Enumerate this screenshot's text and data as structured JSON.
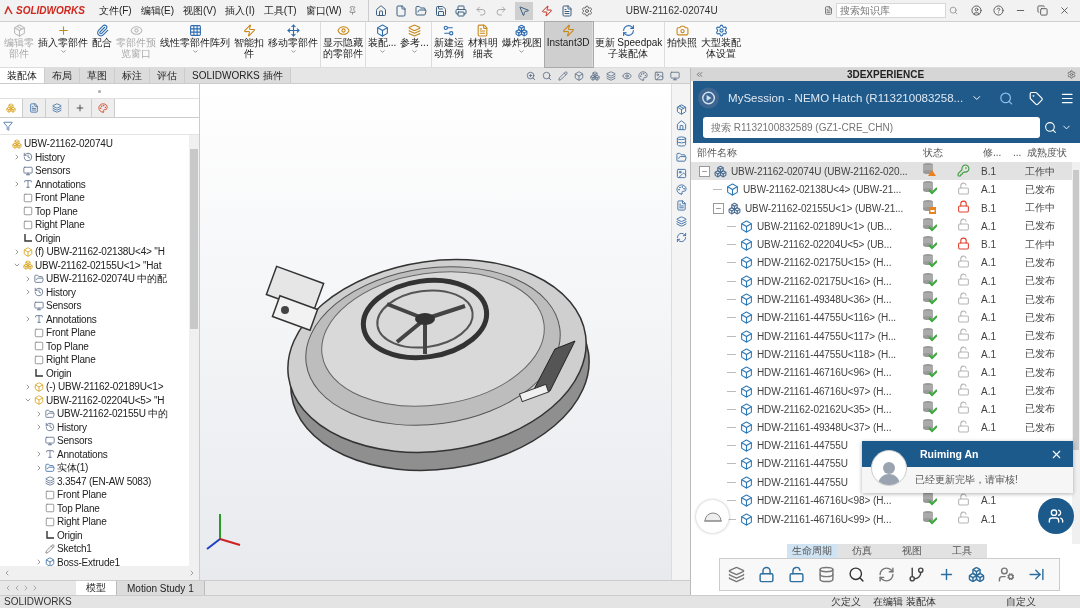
{
  "app": {
    "logo": "SOLIDWORKS",
    "menus": [
      "文件(F)",
      "编辑(E)",
      "视图(V)",
      "插入(I)",
      "工具(T)",
      "窗口(W)"
    ],
    "title": "UBW-21162-02074U",
    "search": {
      "placeholder": "搜索知识库"
    }
  },
  "ribbon": [
    {
      "lines": [
        "编辑零",
        "部件"
      ],
      "disabled": true,
      "selected": false,
      "dropdown": false
    },
    {
      "lines": [
        "插入零部件"
      ],
      "disabled": false,
      "selected": false,
      "dropdown": true
    },
    {
      "lines": [
        "配合"
      ],
      "disabled": false,
      "selected": false,
      "dropdown": false
    },
    {
      "lines": [
        "零部件预",
        "览窗口"
      ],
      "disabled": true,
      "selected": false,
      "dropdown": false
    },
    {
      "lines": [
        "线性零部件阵列"
      ],
      "disabled": false,
      "selected": false,
      "dropdown": true
    },
    {
      "lines": [
        "智能扣",
        "件"
      ],
      "disabled": false,
      "selected": false,
      "dropdown": false
    },
    {
      "lines": [
        "移动零部件"
      ],
      "disabled": false,
      "selected": false,
      "dropdown": true
    },
    {
      "lines": [
        "显示隐藏",
        "的零部件"
      ],
      "disabled": false,
      "selected": false,
      "dropdown": false
    },
    {
      "lines": [
        "装配..."
      ],
      "disabled": false,
      "selected": false,
      "dropdown": true
    },
    {
      "lines": [
        "参考..."
      ],
      "disabled": false,
      "selected": false,
      "dropdown": true
    },
    {
      "lines": [
        "新建运",
        "动算例"
      ],
      "disabled": false,
      "selected": false,
      "dropdown": false
    },
    {
      "lines": [
        "材料明",
        "细表"
      ],
      "disabled": false,
      "selected": false,
      "dropdown": false
    },
    {
      "lines": [
        "爆炸视图"
      ],
      "disabled": false,
      "selected": false,
      "dropdown": true
    },
    {
      "lines": [
        "Instant3D"
      ],
      "disabled": false,
      "selected": true,
      "dropdown": false
    },
    {
      "lines": [
        "更新 Speedpak",
        "子装配体"
      ],
      "disabled": false,
      "selected": false,
      "dropdown": false
    },
    {
      "lines": [
        "拍快照"
      ],
      "disabled": false,
      "selected": false,
      "dropdown": false
    },
    {
      "lines": [
        "大型装配",
        "体设置"
      ],
      "disabled": false,
      "selected": false,
      "dropdown": false
    }
  ],
  "command_tabs": [
    {
      "label": "装配体",
      "selected": true
    },
    {
      "label": "布局",
      "selected": false
    },
    {
      "label": "草图",
      "selected": false
    },
    {
      "label": "标注",
      "selected": false
    },
    {
      "label": "评估",
      "selected": false
    },
    {
      "label": "SOLIDWORKS 插件",
      "selected": false
    }
  ],
  "feature_tree": [
    {
      "label": "UBW-21162-02074U",
      "kind": "assembly",
      "children": [
        {
          "label": "History",
          "kind": "history",
          "expanded": false
        },
        {
          "label": "Sensors",
          "kind": "sensors"
        },
        {
          "label": "Annotations",
          "kind": "annotations",
          "expanded": false
        },
        {
          "label": "Front Plane",
          "kind": "plane"
        },
        {
          "label": "Top Plane",
          "kind": "plane"
        },
        {
          "label": "Right Plane",
          "kind": "plane"
        },
        {
          "label": "Origin",
          "kind": "origin"
        },
        {
          "label": "(f) UBW-21162-02138U<4> \"H",
          "kind": "part",
          "expanded": false
        },
        {
          "label": "UBW-21162-02155U<1> \"Hat",
          "kind": "assembly",
          "expanded": true,
          "children": [
            {
              "label": "UBW-21162-02074U 中的配",
              "kind": "folder",
              "expanded": false
            },
            {
              "label": "History",
              "kind": "history",
              "expanded": false
            },
            {
              "label": "Sensors",
              "kind": "sensors"
            },
            {
              "label": "Annotations",
              "kind": "annotations",
              "expanded": false
            },
            {
              "label": "Front Plane",
              "kind": "plane"
            },
            {
              "label": "Top Plane",
              "kind": "plane"
            },
            {
              "label": "Right Plane",
              "kind": "plane"
            },
            {
              "label": "Origin",
              "kind": "origin"
            },
            {
              "label": "(-) UBW-21162-02189U<1>",
              "kind": "part",
              "expanded": false
            },
            {
              "label": "UBW-21162-02204U<5> \"H",
              "kind": "part",
              "expanded": true,
              "children": [
                {
                  "label": "UBW-21162-02155U 中的",
                  "kind": "folder",
                  "expanded": false
                },
                {
                  "label": "History",
                  "kind": "history",
                  "expanded": false
                },
                {
                  "label": "Sensors",
                  "kind": "sensors"
                },
                {
                  "label": "Annotations",
                  "kind": "annotations",
                  "expanded": false
                },
                {
                  "label": "实体(1)",
                  "kind": "solid",
                  "expanded": false
                },
                {
                  "label": "3.3547 (EN-AW 5083)",
                  "kind": "material"
                },
                {
                  "label": "Front Plane",
                  "kind": "plane"
                },
                {
                  "label": "Top Plane",
                  "kind": "plane"
                },
                {
                  "label": "Right Plane",
                  "kind": "plane"
                },
                {
                  "label": "Origin",
                  "kind": "origin"
                },
                {
                  "label": "Sketch1",
                  "kind": "sketch"
                },
                {
                  "label": "Boss-Extrude1",
                  "kind": "feature",
                  "expanded": false
                }
              ]
            }
          ]
        }
      ]
    }
  ],
  "sheet_tabs": [
    {
      "label": "模型",
      "selected": true
    },
    {
      "label": "Motion Study 1",
      "selected": false
    }
  ],
  "status_bar": {
    "app": "SOLIDWORKS",
    "items": [
      "欠定义",
      "在编辑 装配体",
      "自定义"
    ]
  },
  "experience": {
    "title": "3DEXPERIENCE",
    "session": "MySession - NEMO Hatch (R113210083258...",
    "search": {
      "placeholder": "搜索 R1132100832589 (GZ1-CRE_CHN)"
    },
    "columns": [
      "部件名称",
      "状态",
      "修...",
      "...",
      "成熟度状"
    ],
    "rows": [
      {
        "name": "UBW-21162-02074U (UBW-21162-020...",
        "kind": "assembly",
        "status": {
          "kind": "warning"
        },
        "lock": {
          "kind": "key"
        },
        "revision": "B.1",
        "maturity": "工作中",
        "selected": true,
        "expanded": true,
        "children": [
          {
            "name": "UBW-21162-02138U<4> (UBW-21...",
            "kind": "part",
            "status": {
              "kind": "synced"
            },
            "lock": {
              "kind": "unlocked"
            },
            "revision": "A.1",
            "maturity": "已发布",
            "selected": false
          },
          {
            "name": "UBW-21162-02155U<1> (UBW-21...",
            "kind": "assembly",
            "status": {
              "kind": "saved"
            },
            "lock": {
              "kind": "locked"
            },
            "revision": "B.1",
            "maturity": "工作中",
            "selected": false,
            "expanded": true,
            "children": [
              {
                "name": "UBW-21162-02189U<1> (UB...",
                "kind": "part",
                "status": {
                  "kind": "synced"
                },
                "lock": {
                  "kind": "unlocked"
                },
                "revision": "A.1",
                "maturity": "已发布",
                "selected": false
              },
              {
                "name": "UBW-21162-02204U<5> (UB...",
                "kind": "part",
                "status": {
                  "kind": "synced"
                },
                "lock": {
                  "kind": "locked"
                },
                "revision": "B.1",
                "maturity": "工作中",
                "selected": false
              },
              {
                "name": "HDW-21162-02175U<15> (H...",
                "kind": "part",
                "status": {
                  "kind": "synced"
                },
                "lock": {
                  "kind": "unlocked"
                },
                "revision": "A.1",
                "maturity": "已发布",
                "selected": false
              },
              {
                "name": "HDW-21162-02175U<16> (H...",
                "kind": "part",
                "status": {
                  "kind": "synced"
                },
                "lock": {
                  "kind": "unlocked"
                },
                "revision": "A.1",
                "maturity": "已发布",
                "selected": false
              },
              {
                "name": "HDW-21161-49348U<36> (H...",
                "kind": "part",
                "status": {
                  "kind": "synced"
                },
                "lock": {
                  "kind": "unlocked"
                },
                "revision": "A.1",
                "maturity": "已发布",
                "selected": false
              },
              {
                "name": "HDW-21161-44755U<116> (H...",
                "kind": "part",
                "status": {
                  "kind": "synced"
                },
                "lock": {
                  "kind": "unlocked"
                },
                "revision": "A.1",
                "maturity": "已发布",
                "selected": false
              },
              {
                "name": "HDW-21161-44755U<117> (H...",
                "kind": "part",
                "status": {
                  "kind": "synced"
                },
                "lock": {
                  "kind": "unlocked"
                },
                "revision": "A.1",
                "maturity": "已发布",
                "selected": false
              },
              {
                "name": "HDW-21161-44755U<118> (H...",
                "kind": "part",
                "status": {
                  "kind": "synced"
                },
                "lock": {
                  "kind": "unlocked"
                },
                "revision": "A.1",
                "maturity": "已发布",
                "selected": false
              },
              {
                "name": "HDW-21161-46716U<96> (H...",
                "kind": "part",
                "status": {
                  "kind": "synced"
                },
                "lock": {
                  "kind": "unlocked"
                },
                "revision": "A.1",
                "maturity": "已发布",
                "selected": false
              },
              {
                "name": "HDW-21161-46716U<97> (H...",
                "kind": "part",
                "status": {
                  "kind": "synced"
                },
                "lock": {
                  "kind": "unlocked"
                },
                "revision": "A.1",
                "maturity": "已发布",
                "selected": false
              },
              {
                "name": "HDW-21162-02162U<35> (H...",
                "kind": "part",
                "status": {
                  "kind": "synced"
                },
                "lock": {
                  "kind": "unlocked"
                },
                "revision": "A.1",
                "maturity": "已发布",
                "selected": false
              },
              {
                "name": "HDW-21161-49348U<37> (H...",
                "kind": "part",
                "status": {
                  "kind": "synced"
                },
                "lock": {
                  "kind": "unlocked"
                },
                "revision": "A.1",
                "maturity": "已发布",
                "selected": false
              },
              {
                "name": "HDW-21161-44755U",
                "kind": "part",
                "selected": false
              },
              {
                "name": "HDW-21161-44755U",
                "kind": "part",
                "selected": false
              },
              {
                "name": "HDW-21161-44755U",
                "kind": "part",
                "selected": false
              },
              {
                "name": "HDW-21161-46716U<98> (H...",
                "kind": "part",
                "status": {
                  "kind": "synced"
                },
                "lock": {
                  "kind": "unlocked"
                },
                "revision": "A.1",
                "selected": false
              },
              {
                "name": "HDW-21161-46716U<99> (H...",
                "kind": "part",
                "status": {
                  "kind": "synced"
                },
                "lock": {
                  "kind": "unlocked"
                },
                "revision": "A.1",
                "selected": false
              }
            ]
          }
        ]
      }
    ],
    "notification": {
      "sender": "Ruiming An",
      "message": "已经更新完毕，请审核!"
    },
    "toolbar_tabs": [
      {
        "label": "生命周期",
        "selected": true
      },
      {
        "label": "仿真",
        "selected": false
      },
      {
        "label": "视图",
        "selected": false
      },
      {
        "label": "工具",
        "selected": false
      }
    ]
  }
}
